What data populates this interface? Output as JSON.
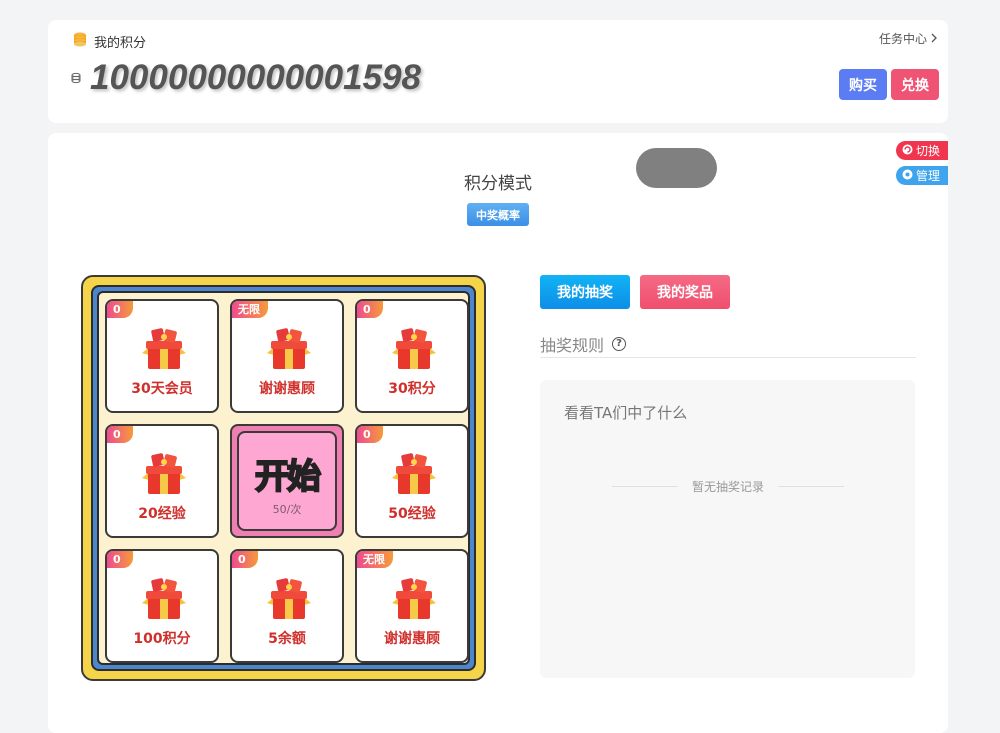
{
  "header": {
    "points_label": "我的积分",
    "task_center": "任务中心",
    "points_value": "10000000000001598",
    "buy_label": "购买",
    "exchange_label": "兑换"
  },
  "lottery": {
    "mode_title": "积分模式",
    "probability_label": "中奖概率",
    "switch_label": "切换",
    "manage_label": "管理",
    "start_label": "开始",
    "start_cost": "50/次",
    "cells": [
      {
        "badge": "0",
        "label": "30天会员"
      },
      {
        "badge": "无限",
        "label": "谢谢惠顾"
      },
      {
        "badge": "0",
        "label": "30积分"
      },
      {
        "badge": "0",
        "label": "20经验"
      },
      {
        "badge": "0",
        "label": "50经验"
      },
      {
        "badge": "0",
        "label": "100积分"
      },
      {
        "badge": "0",
        "label": "5余额"
      },
      {
        "badge": "无限",
        "label": "谢谢惠顾"
      }
    ]
  },
  "panel": {
    "my_draws_label": "我的抽奖",
    "my_prizes_label": "我的奖品",
    "rules_label": "抽奖规则",
    "records_title": "看看TA们中了什么",
    "empty_records": "暂无抽奖记录"
  },
  "colors": {
    "accent_blue": "#5b7cf2",
    "accent_red": "#ef5474",
    "prize_text": "#d0302c"
  }
}
